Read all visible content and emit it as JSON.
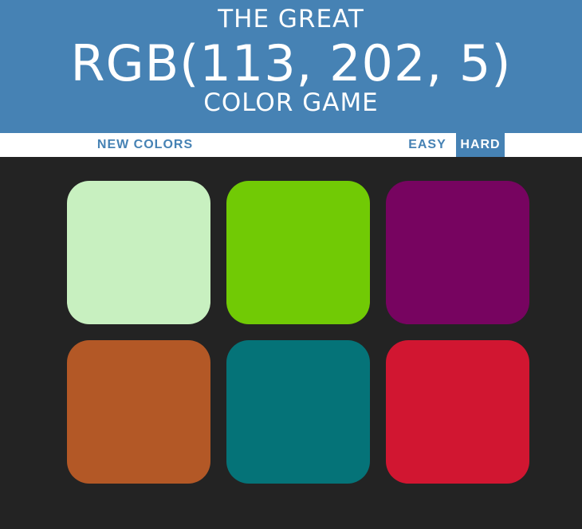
{
  "header": {
    "line1": "THE GREAT",
    "rgb_display": "RGB(113, 202, 5)",
    "line3": "COLOR GAME",
    "background": "#4682b4"
  },
  "controls": {
    "reset_label": "NEW COLORS",
    "easy_label": "EASY",
    "hard_label": "HARD",
    "selected_mode": "HARD",
    "message": ""
  },
  "squares": [
    {
      "color": "#c8f0c0"
    },
    {
      "color": "#71ca05"
    },
    {
      "color": "#770460"
    },
    {
      "color": "#b35826"
    },
    {
      "color": "#057378"
    },
    {
      "color": "#d11631"
    }
  ],
  "page_background": "#232323"
}
